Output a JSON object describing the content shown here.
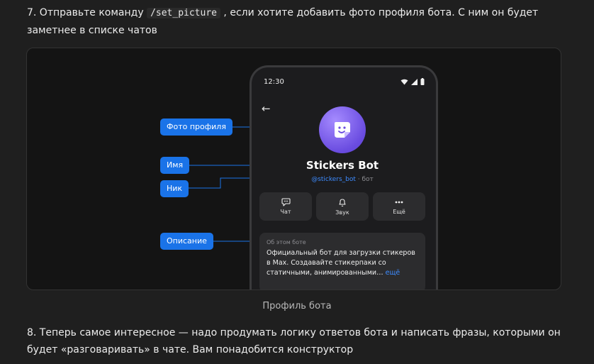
{
  "step7": {
    "before": "7. Отправьте команду ",
    "command": "/set_picture",
    "after": " , если хотите добавить фото профиля бота. С ним он будет заметнее в списке чатов"
  },
  "figure": {
    "caption": "Профиль бота",
    "callouts": {
      "photo": "Фото профиля",
      "name": "Имя",
      "nick": "Ник",
      "description": "Описание"
    },
    "phone": {
      "time": "12:30",
      "bot_name": "Stickers Bot",
      "bot_nick": "@stickers_bot",
      "bot_suffix": " · бот",
      "actions": [
        "Чат",
        "Звук",
        "Ещё"
      ],
      "about_title": "Об этом боте",
      "about_text": "Официальный бот для загрузки стикеров в Max. Создавайте стикерпаки со статичными, анимированными…",
      "about_more": "ещё"
    }
  },
  "step8": {
    "text": "8. Теперь самое интересное — надо продумать логику ответов бота и написать фразы, которыми он будет «разговаривать» в чате. Вам понадобится конструктор"
  },
  "colors": {
    "accent": "#1a73e8",
    "link": "#3d8bff",
    "avatar": "#7b5cf0"
  }
}
